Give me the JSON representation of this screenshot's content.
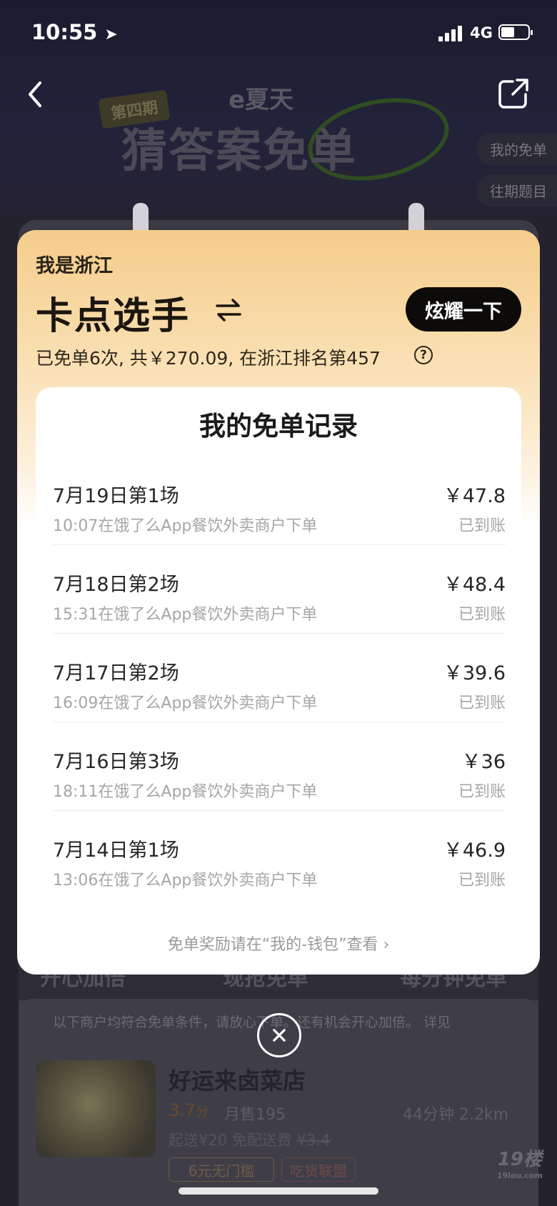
{
  "status_bar": {
    "time": "10:55",
    "network": "4G"
  },
  "background": {
    "issue_badge": "第四期",
    "brand": "e夏天",
    "title": "猜答案免单",
    "side_links": [
      "我的免单",
      "往期题目"
    ],
    "tabs": [
      "开心加倍",
      "现抢免单",
      "每分钟免单"
    ],
    "notice": "以下商户均符合免单条件，请放心下单。还有机会开心加倍。 详见",
    "shop": {
      "name": "好运来卤菜店",
      "rating": "3.7",
      "rating_unit": "分",
      "sales": "月售195",
      "time_distance": "44分钟  2.2km",
      "fee": "起送¥20  免配送费",
      "old_fee": "¥3.4",
      "badges": [
        "6元无门槛",
        "吃货联盟"
      ]
    },
    "watermark": "19楼",
    "watermark_sub": "19lou.com"
  },
  "modal": {
    "region": "我是浙江",
    "level": "卡点选手",
    "show_button": "炫耀一下",
    "stats": "已免单6次, 共￥270.09, 在浙江排名第457",
    "help": "?",
    "records_title": "我的免单记录",
    "records": [
      {
        "date": "7月19日第1场",
        "amount": "￥47.8",
        "desc": "10:07在饿了么App餐饮外卖商户下单",
        "status": "已到账"
      },
      {
        "date": "7月18日第2场",
        "amount": "￥48.4",
        "desc": "15:31在饿了么App餐饮外卖商户下单",
        "status": "已到账"
      },
      {
        "date": "7月17日第2场",
        "amount": "￥39.6",
        "desc": "16:09在饿了么App餐饮外卖商户下单",
        "status": "已到账"
      },
      {
        "date": "7月16日第3场",
        "amount": "￥36",
        "desc": "18:11在饿了么App餐饮外卖商户下单",
        "status": "已到账"
      },
      {
        "date": "7月14日第1场",
        "amount": "￥46.9",
        "desc": "13:06在饿了么App餐饮外卖商户下单",
        "status": "已到账"
      }
    ],
    "footer_link": "免单奖励请在“我的-钱包”查看 ›"
  }
}
